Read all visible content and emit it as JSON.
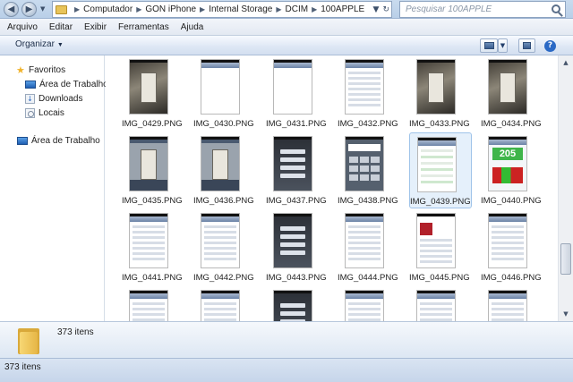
{
  "address": {
    "crumbs": [
      "Computador",
      "GON iPhone",
      "Internal Storage",
      "DCIM",
      "100APPLE"
    ],
    "search_placeholder": "Pesquisar 100APPLE"
  },
  "menu": [
    "Arquivo",
    "Editar",
    "Exibir",
    "Ferramentas",
    "Ajuda"
  ],
  "toolbar": {
    "organize_label": "Organizar",
    "help_label": "?"
  },
  "nav": {
    "favorites_label": "Favoritos",
    "favorites": [
      "Área de Trabalho",
      "Downloads",
      "Locais"
    ],
    "desktop_label": "Área de Trabalho"
  },
  "files": [
    "IMG_0429.PNG",
    "IMG_0430.PNG",
    "IMG_0431.PNG",
    "IMG_0432.PNG",
    "IMG_0433.PNG",
    "IMG_0434.PNG",
    "IMG_0435.PNG",
    "IMG_0436.PNG",
    "IMG_0437.PNG",
    "IMG_0438.PNG",
    "IMG_0439.PNG",
    "IMG_0440.PNG",
    "IMG_0441.PNG",
    "IMG_0442.PNG",
    "IMG_0443.PNG",
    "IMG_0444.PNG",
    "IMG_0445.PNG",
    "IMG_0446.PNG",
    "",
    "",
    "",
    "",
    "",
    ""
  ],
  "selected_file": "IMG_0439.PNG",
  "thumb_text": {
    "counter": "205"
  },
  "details": {
    "count": "373 itens"
  },
  "status": {
    "count": "373 itens"
  }
}
